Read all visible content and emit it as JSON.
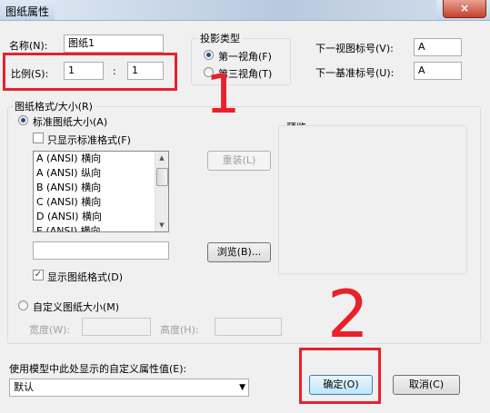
{
  "window": {
    "title": "图纸属性",
    "close_icon": "×"
  },
  "name": {
    "label": "名称(N):",
    "value": "图纸1"
  },
  "scale": {
    "label": "比例(S):",
    "left": "1",
    "separator": ":",
    "right": "1"
  },
  "projection": {
    "label": "投影类型",
    "first_angle": "第一视角(F)",
    "third_angle": "第三视角(T)",
    "selected": "first_angle"
  },
  "next_view_label": {
    "label": "下一视图标号(V):",
    "value": "A"
  },
  "next_datum_label": {
    "label": "下一基准标号(U):",
    "value": "A"
  },
  "sheet_format": {
    "label": "图纸格式/大小(R)",
    "standard_size": "标准图纸大小(A)",
    "only_standard": "只显示标准格式(F)",
    "items": [
      "A (ANSI) 横向",
      "A (ANSI) 纵向",
      "B (ANSI) 横向",
      "C (ANSI) 横向",
      "D (ANSI) 横向",
      "E (ANSI) 横向"
    ],
    "reload": "重装(L)",
    "browse": "浏览(B)...",
    "display_format": "显示图纸格式(D)",
    "custom_size": "自定义图纸大小(M)",
    "width_label": "宽度(W):",
    "height_label": "高度(H):",
    "preview_label": "预览"
  },
  "custom_prop": {
    "label": "使用模型中此处显示的自定义属性值(E):",
    "value": "默认"
  },
  "buttons": {
    "ok": "确定(O)",
    "cancel": "取消(C)"
  },
  "annotations": {
    "one": "1",
    "two": "2"
  }
}
